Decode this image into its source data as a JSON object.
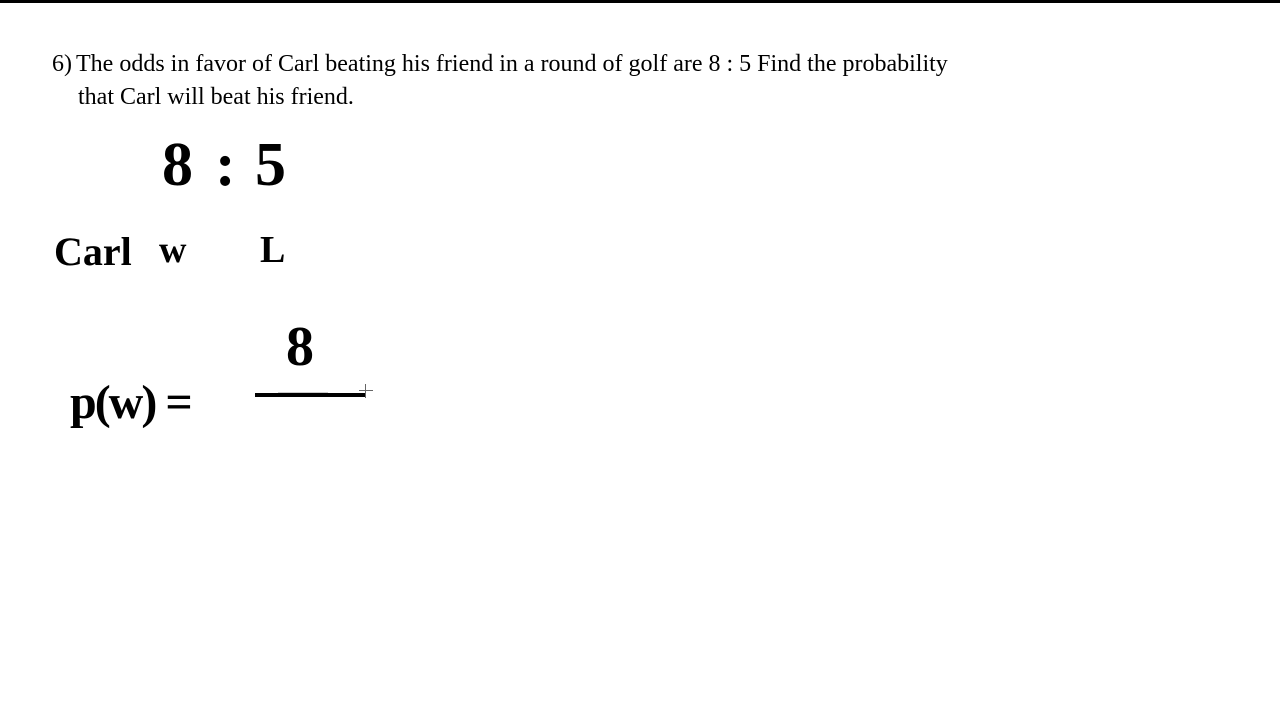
{
  "problem": {
    "number": "6)",
    "text_line1": "The odds in favor of Carl beating his friend in a round of golf are 8 : 5  Find the probability",
    "text_line2": "that Carl will beat his friend."
  },
  "handwriting": {
    "odds_left": "8",
    "odds_colon": ":",
    "odds_right": "5",
    "name": "Carl",
    "win_label": "w",
    "lose_label": "L",
    "prob_expr": "p(w) =",
    "numerator": "8"
  }
}
